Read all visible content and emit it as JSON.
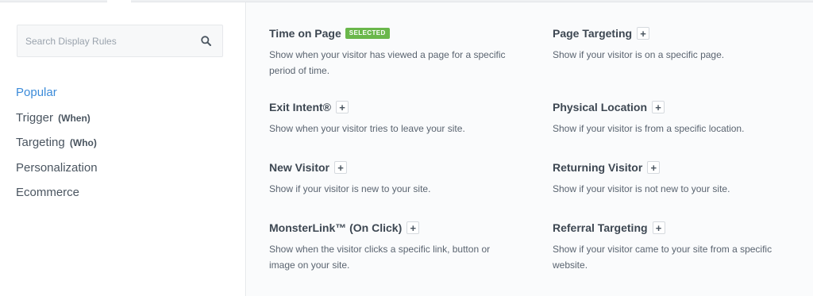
{
  "search": {
    "placeholder": "Search Display Rules"
  },
  "sidebar": {
    "items": [
      {
        "label": "Popular",
        "sub": ""
      },
      {
        "label": "Trigger",
        "sub": "(When)"
      },
      {
        "label": "Targeting",
        "sub": "(Who)"
      },
      {
        "label": "Personalization",
        "sub": ""
      },
      {
        "label": "Ecommerce",
        "sub": ""
      }
    ],
    "active_index": 0
  },
  "rules": [
    {
      "title": "Time on Page",
      "badge": "SELECTED",
      "desc": "Show when your visitor has viewed a page for a specific period of time."
    },
    {
      "title": "Page Targeting",
      "plus": "+",
      "desc": "Show if your visitor is on a specific page."
    },
    {
      "title": "Exit Intent®",
      "plus": "+",
      "desc": "Show when your visitor tries to leave your site."
    },
    {
      "title": "Physical Location",
      "plus": "+",
      "desc": "Show if your visitor is from a specific location."
    },
    {
      "title": "New Visitor",
      "plus": "+",
      "desc": "Show if your visitor is new to your site."
    },
    {
      "title": "Returning Visitor",
      "plus": "+",
      "desc": "Show if your visitor is not new to your site."
    },
    {
      "title": "MonsterLink™ (On Click)",
      "plus": "+",
      "desc": "Show when the visitor clicks a specific link, button or image on your site."
    },
    {
      "title": "Referral Targeting",
      "plus": "+",
      "desc": "Show if your visitor came to your site from a specific website."
    }
  ],
  "colors": {
    "accent": "#3c8bd9",
    "selected_badge": "#6ab74b",
    "main_bg": "#fafbfc"
  },
  "icons": {
    "search": "search-icon",
    "add": "plus-icon"
  }
}
